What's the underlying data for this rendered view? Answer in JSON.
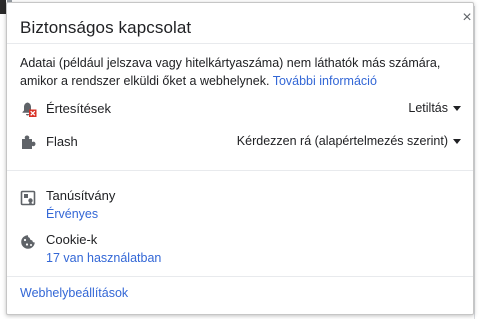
{
  "popup": {
    "title": "Biztonságos kapcsolat",
    "close_symbol": "×",
    "description": "Adatai (például jelszava vagy hitelkártyaszáma) nem láthatók más számára, amikor a rendszer elküldi őket a webhelynek.",
    "more_info_link": "További információ"
  },
  "permissions": [
    {
      "label": "Értesítések",
      "value": "Letiltás",
      "icon": "notifications-blocked-icon"
    },
    {
      "label": "Flash",
      "value": "Kérdezzen rá (alapértelmezés szerint)",
      "icon": "puzzle-icon"
    }
  ],
  "info": {
    "certificate": {
      "title": "Tanúsítvány",
      "status": "Érvényes",
      "icon": "certificate-icon"
    },
    "cookies": {
      "title": "Cookie-k",
      "status": "17 van használatban",
      "icon": "cookie-icon"
    }
  },
  "footer": {
    "site_settings_link": "Webhelybeállítások"
  },
  "colors": {
    "link": "#3367d6",
    "text": "#202124",
    "icon": "#5f6368",
    "blocked_badge": "#d93025"
  }
}
